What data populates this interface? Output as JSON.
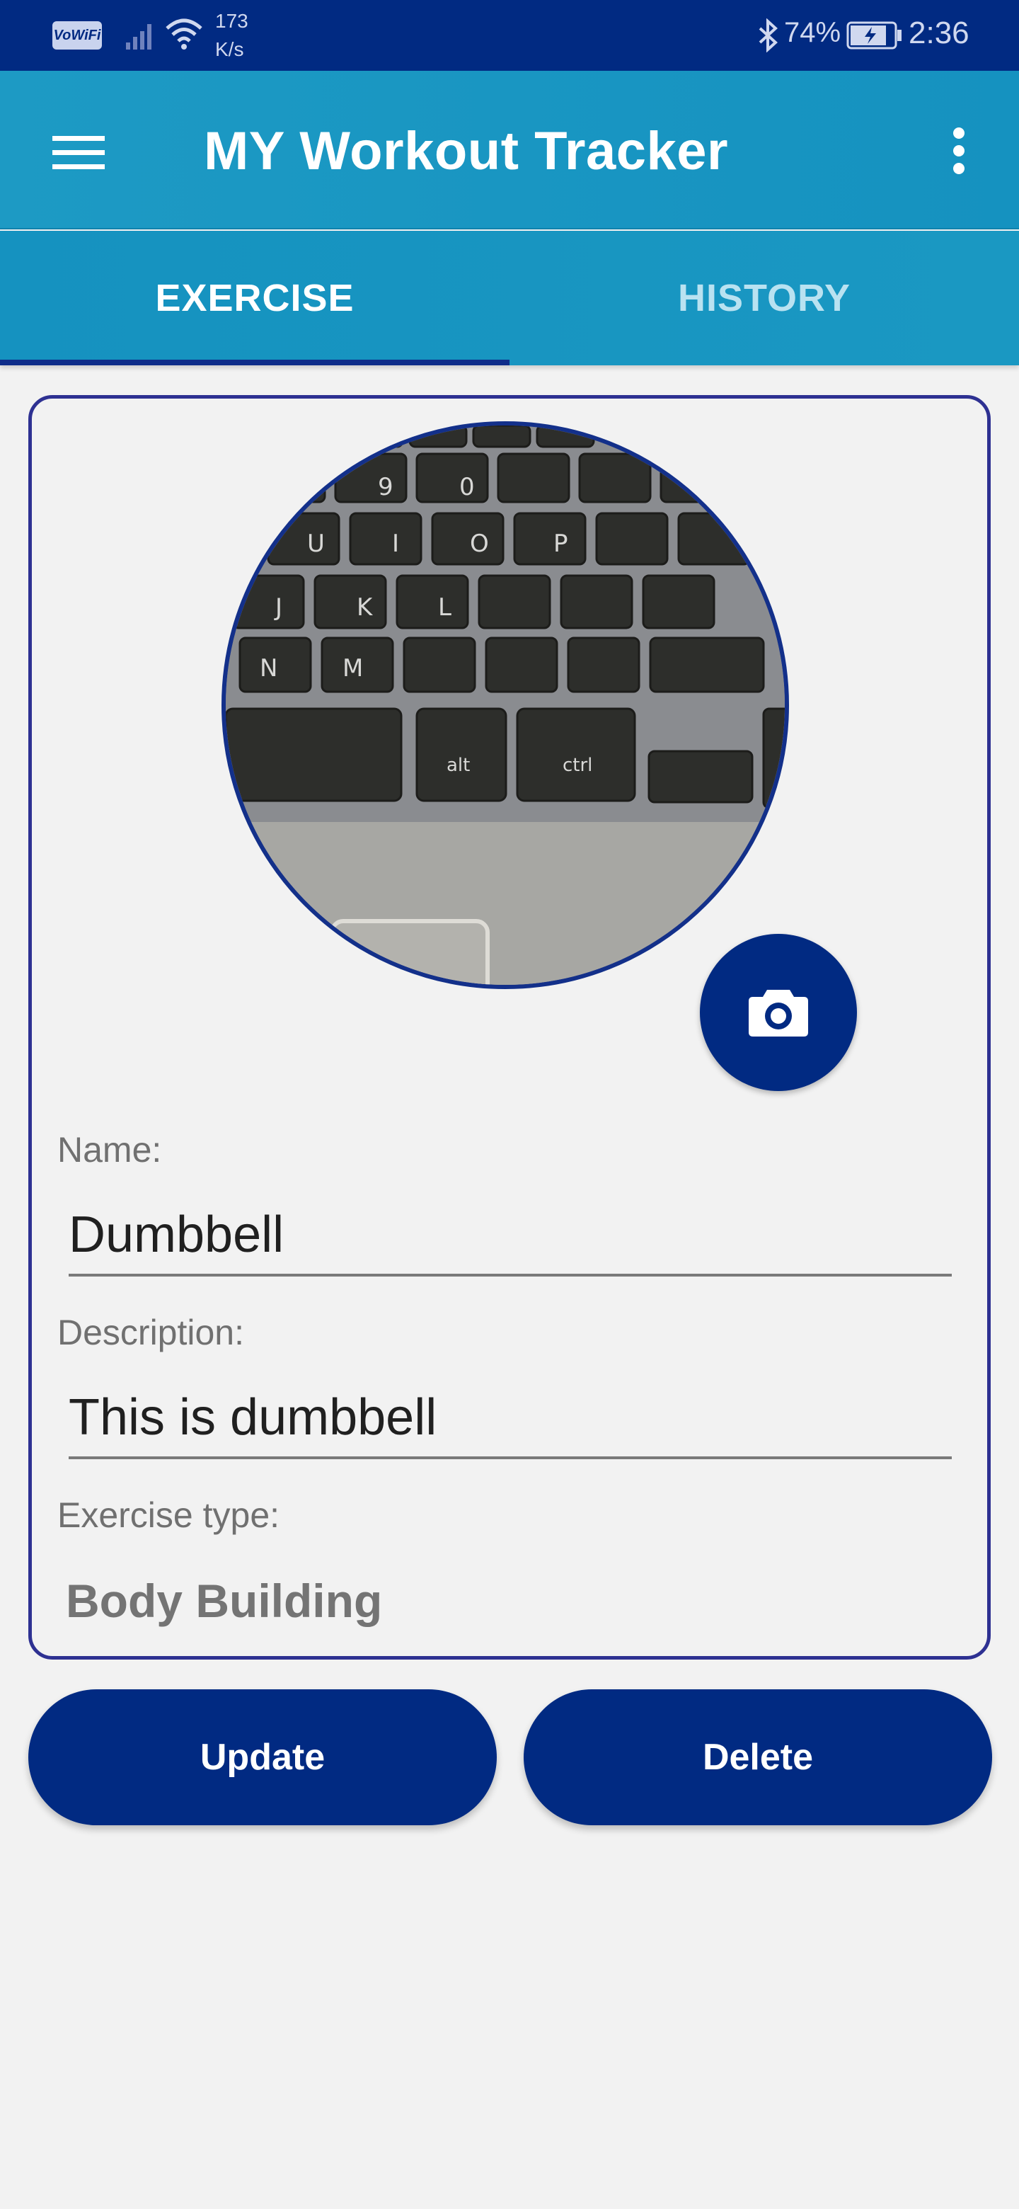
{
  "status_bar": {
    "vowifi": "VoWiFi",
    "net_speed_value": "173",
    "net_speed_unit": "K/s",
    "battery": "74%",
    "time": "2:36"
  },
  "app_bar": {
    "title": "MY Workout Tracker"
  },
  "tabs": [
    {
      "label": "EXERCISE",
      "selected": true
    },
    {
      "label": "HISTORY",
      "selected": false
    }
  ],
  "form": {
    "name_label": "Name:",
    "name_value": "Dumbbell",
    "description_label": "Description:",
    "description_value": "This is dumbbell",
    "type_label": "Exercise type:",
    "type_value": "Body Building"
  },
  "buttons": {
    "update": "Update",
    "delete": "Delete"
  },
  "colors": {
    "status_bar": "#012a82",
    "app_bar": "#1592c0",
    "accent": "#012a82"
  },
  "icons": {
    "menu": "menu-icon",
    "more": "more-vert-icon",
    "camera": "camera-icon"
  }
}
